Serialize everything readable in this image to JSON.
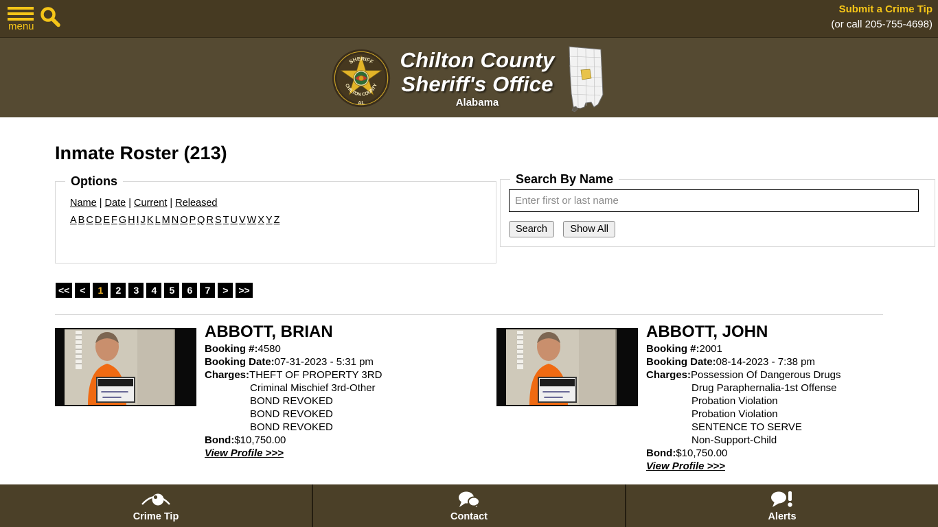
{
  "topbar": {
    "menu_label": "menu",
    "menu_icon": "hamburger-icon",
    "search_icon": "search-icon",
    "crime_tip_link": "Submit a Crime Tip",
    "crime_tip_phone": "(or call 205-755-4698)"
  },
  "brand": {
    "badge_icon": "sheriff-badge-icon",
    "badge_text_top": "SHERIFF",
    "badge_text_bottom": "CHILTON COUNTY",
    "badge_text_state": "AL",
    "title_line1": "Chilton County",
    "title_line2": "Sheriff's Office",
    "subtitle": "Alabama",
    "map_icon": "alabama-state-map-icon"
  },
  "page": {
    "title": "Inmate Roster (213)"
  },
  "options_panel": {
    "legend": "Options",
    "sort_links": [
      "Name",
      "Date",
      "Current",
      "Released"
    ],
    "separator": "|",
    "alphabet": [
      "A",
      "B",
      "C",
      "D",
      "E",
      "F",
      "G",
      "H",
      "I",
      "J",
      "K",
      "L",
      "M",
      "N",
      "O",
      "P",
      "Q",
      "R",
      "S",
      "T",
      "U",
      "V",
      "W",
      "X",
      "Y",
      "Z"
    ]
  },
  "search_panel": {
    "legend": "Search By Name",
    "placeholder": "Enter first or last name",
    "value": "",
    "search_button": "Search",
    "show_all_button": "Show All"
  },
  "pagination": {
    "first": "<<",
    "prev": "<",
    "pages": [
      "1",
      "2",
      "3",
      "4",
      "5",
      "6",
      "7"
    ],
    "current": "1",
    "next": ">",
    "last": ">>",
    "active_color": "#f0b429"
  },
  "labels": {
    "booking_num": "Booking #:",
    "booking_date": "Booking Date:",
    "charges": "Charges:",
    "bond": "Bond:",
    "view_profile": "View Profile >>>"
  },
  "records": [
    {
      "name": "ABBOTT, BRIAN",
      "booking_number": "4580",
      "booking_date": "07-31-2023 - 5:31 pm",
      "charges": [
        "THEFT OF PROPERTY 3RD",
        "Criminal Mischief 3rd-Other",
        "BOND REVOKED",
        "BOND REVOKED",
        "BOND REVOKED"
      ],
      "bond": "$10,750.00",
      "mugshot_name_card": "Abbott, Brian Dwight"
    },
    {
      "name": "ABBOTT, JOHN",
      "booking_number": "2001",
      "booking_date": "08-14-2023 - 7:38 pm",
      "charges": [
        "Possession Of Dangerous Drugs",
        "Drug Paraphernalia-1st Offense",
        "Probation Violation",
        "Probation Violation",
        "SENTENCE TO SERVE",
        "Non-Support-Child"
      ],
      "bond": "$10,750.00",
      "mugshot_name_card": "Abbott John Wesley"
    }
  ],
  "footer": {
    "items": [
      {
        "label": "Crime Tip",
        "icon": "eye-icon"
      },
      {
        "label": "Contact",
        "icon": "speech-bubbles-icon"
      },
      {
        "label": "Alerts",
        "icon": "alert-bubble-icon"
      }
    ]
  },
  "colors": {
    "topbar_brown": "#463a22",
    "band_brown": "#554a32",
    "footer_brown": "#4b4028",
    "accent_gold": "#f5c518"
  }
}
